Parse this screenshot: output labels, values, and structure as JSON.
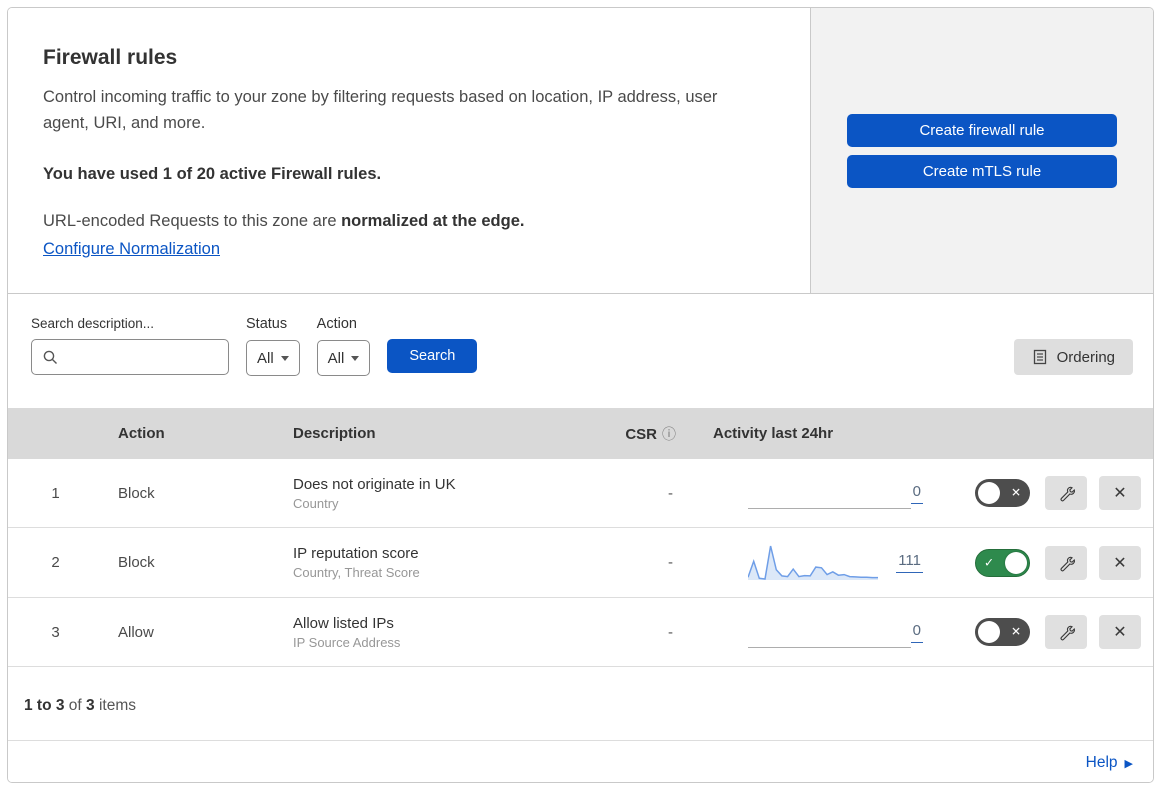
{
  "header": {
    "title": "Firewall rules",
    "description": "Control incoming traffic to your zone by filtering requests based on location, IP address, user agent, URI, and more.",
    "usage_text": "You have used 1 of 20 active Firewall rules.",
    "normalization_prefix": "URL-encoded Requests to this zone are ",
    "normalization_bold": "normalized at the edge.",
    "normalization_link": "Configure Normalization",
    "create_firewall_button": "Create firewall rule",
    "create_mtls_button": "Create mTLS rule"
  },
  "filters": {
    "search_label": "Search description...",
    "status_label": "Status",
    "status_value": "All",
    "action_label": "Action",
    "action_value": "All",
    "search_button": "Search",
    "ordering_button": "Ordering"
  },
  "table": {
    "columns": {
      "action": "Action",
      "description": "Description",
      "csr": "CSR",
      "activity": "Activity last 24hr"
    },
    "rows": [
      {
        "priority": "1",
        "action": "Block",
        "description": "Does not originate in UK",
        "fields": "Country",
        "csr": "-",
        "activity_count": "0",
        "has_sparkline": false,
        "enabled": false
      },
      {
        "priority": "2",
        "action": "Block",
        "description": "IP reputation score",
        "fields": "Country, Threat Score",
        "csr": "-",
        "activity_count": "111",
        "has_sparkline": true,
        "enabled": true
      },
      {
        "priority": "3",
        "action": "Allow",
        "description": "Allow listed IPs",
        "fields": "IP Source Address",
        "csr": "-",
        "activity_count": "0",
        "has_sparkline": false,
        "enabled": false
      }
    ]
  },
  "footer": {
    "range_bold": "1 to 3",
    "of_text": " of ",
    "total_bold": "3",
    "items_text": " items",
    "help_link": "Help"
  },
  "chart_data": {
    "type": "area",
    "title": "Activity last 24hr sparkline (rule 2: IP reputation score)",
    "x_description": "last 24 hours, unlabeled hourly buckets",
    "values": [
      8,
      55,
      5,
      3,
      100,
      30,
      12,
      10,
      32,
      10,
      13,
      12,
      38,
      36,
      16,
      24,
      14,
      16,
      10,
      9,
      8,
      8,
      7,
      7
    ],
    "total_label": "111",
    "ylim": [
      0,
      100
    ],
    "grid": false,
    "legend": false
  },
  "colors": {
    "accent_blue": "#0b55c4",
    "toggle_on_green": "#2e8a4d",
    "toggle_off_gray": "#4d4d4d",
    "sparkline_line": "#6f9ee7",
    "sparkline_fill": "#dce8f8",
    "table_header_bg": "#d9d9d9",
    "panel_gray": "#f2f2f2"
  }
}
